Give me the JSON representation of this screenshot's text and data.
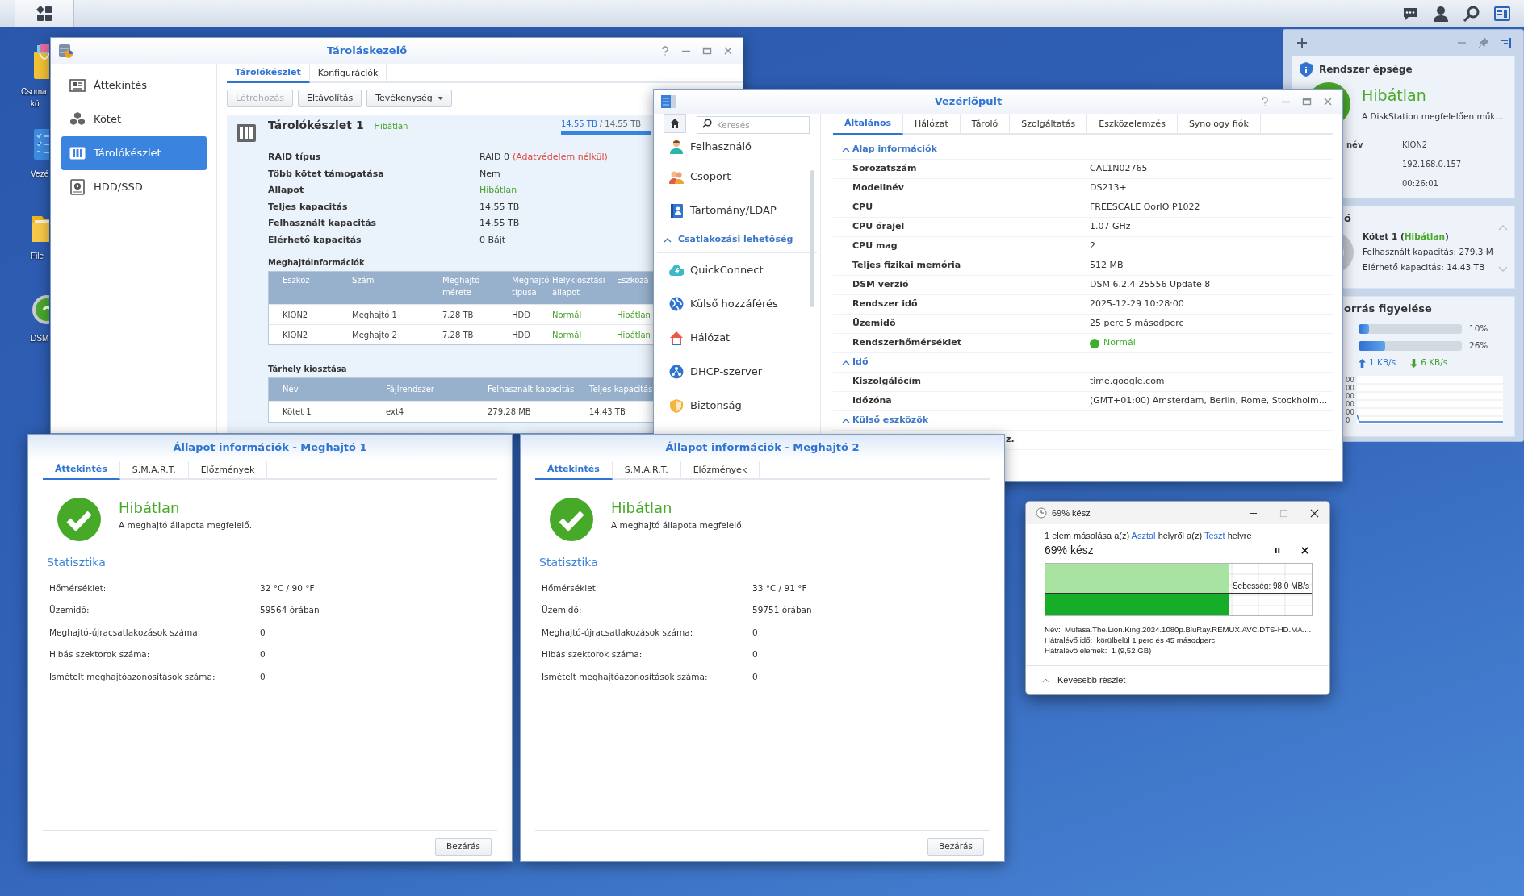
{
  "desktop_icons": [
    {
      "kind": "package",
      "lines": [
        "Csoma",
        "kö"
      ]
    },
    {
      "kind": "control",
      "lines": [
        "Vezé"
      ]
    },
    {
      "kind": "folder",
      "lines": [
        "File"
      ]
    },
    {
      "kind": "dsm",
      "lines": [
        "DSM"
      ]
    }
  ],
  "storage_manager": {
    "title": "Tároláskezelő",
    "sidebar": [
      {
        "kind": "overview",
        "label": "Áttekintés",
        "selected": false
      },
      {
        "kind": "volume",
        "label": "Kötet",
        "selected": false
      },
      {
        "kind": "pool",
        "label": "Tárolókészlet",
        "selected": true
      },
      {
        "kind": "disk",
        "label": "HDD/SSD",
        "selected": false
      }
    ],
    "tabs": [
      {
        "label": "Tárolókészlet",
        "selected": true
      },
      {
        "label": "Konfigurációk",
        "selected": false
      }
    ],
    "buttons": [
      {
        "label": "Létrehozás",
        "disabled": true,
        "dropdown": false
      },
      {
        "label": "Eltávolítás",
        "disabled": false,
        "dropdown": false
      },
      {
        "label": "Tevékenység",
        "disabled": false,
        "dropdown": true
      }
    ],
    "pool": {
      "name": "Tárolókészlet 1",
      "status": "- Hibátlan",
      "used": "14.55 TB",
      "total": "/ 14.55 TB",
      "level": 1
    },
    "details": [
      {
        "label": "RAID típus",
        "value": "RAID 0",
        "note": "(Adatvédelem nélkül)",
        "healthy": false
      },
      {
        "label": "Több kötet támogatása",
        "value": "Nem",
        "healthy": false
      },
      {
        "label": "Állapot",
        "value": "Hibátlan",
        "healthy": true
      },
      {
        "label": "Teljes kapacitás",
        "value": "14.55 TB",
        "healthy": false
      },
      {
        "label": "Felhasznált kapacitás",
        "value": "14.55 TB",
        "healthy": false
      },
      {
        "label": "Elérhető kapacitás",
        "value": "0 Bájt",
        "healthy": false
      }
    ],
    "drive_table": {
      "title": "Meghajtóinformációk",
      "columns": [
        {
          "label": "Eszköz",
          "healthy": false
        },
        {
          "label": "Szám",
          "healthy": false
        },
        {
          "label": "Meghajtó mérete",
          "healthy": false
        },
        {
          "label": "Meghajtó típusa",
          "healthy": false
        },
        {
          "label": "Helykiosztási állapot",
          "healthy": true
        },
        {
          "label": "Eszközá",
          "healthy": true
        }
      ],
      "rows": [
        [
          "KION2",
          "Meghajtó 1",
          "7.28 TB",
          "HDD",
          "Normál",
          "Hibátlan"
        ],
        [
          "KION2",
          "Meghajtó 2",
          "7.28 TB",
          "HDD",
          "Normál",
          "Hibátlan"
        ]
      ]
    },
    "allocation_table": {
      "title": "Tárhely kiosztása",
      "columns": [
        {
          "label": "Név",
          "healthy": false
        },
        {
          "label": "Fájlrendszer",
          "healthy": false
        },
        {
          "label": "Felhasznált kapacitás",
          "healthy": false
        },
        {
          "label": "Teljes kapacitás",
          "healthy": false
        }
      ],
      "rows": [
        [
          "Kötet 1",
          "ext4",
          "279.28 MB",
          "14.43 TB"
        ]
      ]
    }
  },
  "control_panel": {
    "title": "Vezérlőpult",
    "search": {
      "placeholder": "Keresés"
    },
    "sidebar": [
      {
        "kind": "user",
        "label": "Felhasználó"
      },
      {
        "kind": "group",
        "label": "Csoport"
      },
      {
        "kind": "ldap",
        "label": "Tartomány/LDAP"
      },
      {
        "kind": "section",
        "label": "Csatlakozási lehetőség"
      },
      {
        "kind": "quickconnect",
        "label": "QuickConnect"
      },
      {
        "kind": "globe",
        "label": "Külső hozzáférés"
      },
      {
        "kind": "house",
        "label": "Hálózat"
      },
      {
        "kind": "dhcp",
        "label": "DHCP-szerver"
      },
      {
        "kind": "shield",
        "label": "Biztonság"
      }
    ],
    "tabs": [
      {
        "label": "Általános",
        "selected": true
      },
      {
        "label": "Hálózat",
        "selected": false
      },
      {
        "label": "Tároló",
        "selected": false
      },
      {
        "label": "Szolgáltatás",
        "selected": false
      },
      {
        "label": "Eszközelemzés",
        "selected": false
      },
      {
        "label": "Synology fiók",
        "selected": false
      }
    ],
    "sections": [
      {
        "title": "Alap információk",
        "expanded": true,
        "rows": [
          {
            "label": "Sorozatszám",
            "value": "CAL1N02765"
          },
          {
            "label": "Modellnév",
            "value": "DS213+"
          },
          {
            "label": "CPU",
            "value": "FREESCALE QorIQ P1022"
          },
          {
            "label": "CPU órajel",
            "value": "1.07 GHz"
          },
          {
            "label": "CPU mag",
            "value": "2"
          },
          {
            "label": "Teljes fizikai memória",
            "value": "512 MB"
          },
          {
            "label": "DSM verzió",
            "value": "DSM 6.2.4-25556 Update 8"
          },
          {
            "label": "Rendszer idő",
            "value": "2025-12-29 10:28:00"
          },
          {
            "label": "Üzemidő",
            "value": "25 perc 5 másodperc"
          },
          {
            "label": "Rendszerhőmérséklet",
            "value": "Normál",
            "healthy": true
          }
        ]
      },
      {
        "title": "Idő",
        "expanded": true,
        "rows": [
          {
            "label": "Kiszolgálócím",
            "value": "time.google.com"
          },
          {
            "label": "Időzóna",
            "value": "(GMT+01:00) Amsterdam, Berlin, Rome, Stockholm..."
          }
        ]
      },
      {
        "title": "Külső eszközök",
        "expanded": true,
        "rows": [
          {
            "note": "z."
          }
        ]
      }
    ]
  },
  "widget_panel": {
    "health": {
      "title": "Rendszer épsége",
      "status": "Hibátlan",
      "description": "A DiskStation megfelelően műk...",
      "rows": [
        {
          "label": "név",
          "value": "KION2"
        },
        {
          "value": "192.168.0.157"
        },
        {
          "value": "00:26:01"
        }
      ]
    },
    "storage": {
      "heading": "ó",
      "title_parts": [
        {
          "text": "Kötet 1 (",
          "healthy": false
        },
        {
          "text": "Hibátlan",
          "healthy": true
        },
        {
          "text": ")",
          "healthy": false
        }
      ],
      "lines": [
        "Felhasznált kapacitás: 279.3 M",
        "Elérhető kapacitás: 14.43 TB"
      ]
    },
    "monitor": {
      "heading": "orrás figyelése",
      "meters": [
        {
          "level": 0.1,
          "reading": "10%"
        },
        {
          "level": 0.26,
          "reading": "26%"
        }
      ],
      "upload": "1 KB/s",
      "download": "6 KB/s",
      "axis_labels": [
        "00",
        "00",
        "00",
        "00",
        "00",
        "0"
      ]
    }
  },
  "drive_windows": [
    {
      "title": "Állapot információk - Meghajtó 1",
      "tabs": [
        {
          "label": "Áttekintés",
          "selected": true
        },
        {
          "label": "S.M.A.R.T.",
          "selected": false
        },
        {
          "label": "Előzmények",
          "selected": false
        }
      ],
      "status": "Hibátlan",
      "description": "A meghajtó állapota megfelelő.",
      "section": "Statisztika",
      "stats": [
        {
          "label": "Hőmérséklet:",
          "value": "32 °C / 90 °F"
        },
        {
          "label": "Üzemidő:",
          "value": "59564 órában"
        },
        {
          "label": "Meghajtó-újracsatlakozások száma:",
          "value": "0"
        },
        {
          "label": "Hibás szektorok száma:",
          "value": "0"
        },
        {
          "label": "Ismételt meghajtóazonosítások száma:",
          "value": "0"
        }
      ],
      "close": "Bezárás"
    },
    {
      "title": "Állapot információk - Meghajtó 2",
      "tabs": [
        {
          "label": "Áttekintés",
          "selected": true
        },
        {
          "label": "S.M.A.R.T.",
          "selected": false
        },
        {
          "label": "Előzmények",
          "selected": false
        }
      ],
      "status": "Hibátlan",
      "description": "A meghajtó állapota megfelelő.",
      "section": "Statisztika",
      "stats": [
        {
          "label": "Hőmérséklet:",
          "value": "33 °C / 91 °F"
        },
        {
          "label": "Üzemidő:",
          "value": "59751 órában"
        },
        {
          "label": "Meghajtó-újracsatlakozások száma:",
          "value": "0"
        },
        {
          "label": "Hibás szektorok száma:",
          "value": "0"
        },
        {
          "label": "Ismételt meghajtóazonosítások száma:",
          "value": "0"
        }
      ],
      "close": "Bezárás"
    }
  ],
  "copy_dialog": {
    "title": "69% kész",
    "description_parts": [
      {
        "text": "1 elem másolása a(z) ",
        "link": false
      },
      {
        "text": "Asztal",
        "link": true
      },
      {
        "text": " helyről a(z) ",
        "link": false
      },
      {
        "text": "Teszt",
        "link": true
      },
      {
        "text": " helyre",
        "link": false
      }
    ],
    "progress_text": "69% kész",
    "level": 0.69,
    "speed": "Sebesség: 98,0 MB/s",
    "details": [
      "Név:  Mufasa.The.Lion.King.2024.1080p.BluRay.REMUX.AVC.DTS-HD.MA....",
      "Hátralévő idő:  körülbelül 1 perc és 45 másodperc",
      "Hátralévő elemek:  1 (9,52 GB)"
    ],
    "toggle": "Kevesebb részlet"
  }
}
